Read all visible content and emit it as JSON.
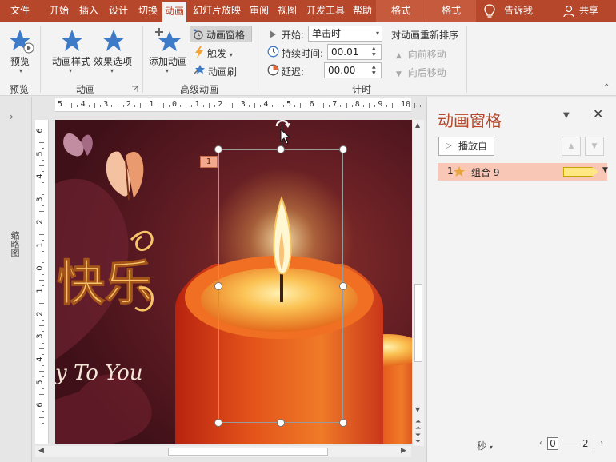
{
  "tabs": {
    "file": "文件",
    "home": "开始",
    "insert": "插入",
    "design": "设计",
    "transitions": "切换",
    "animations": "动画",
    "slideshow": "幻灯片放映",
    "review": "审阅",
    "view": "视图",
    "developer": "开发工具",
    "help": "帮助",
    "format1": "格式",
    "format2": "格式",
    "tellme": "告诉我",
    "share": "共享"
  },
  "ribbon": {
    "preview_btn": "预览",
    "preview_group": "预览",
    "anim_style_btn": "动画样式",
    "effect_opts_btn": "效果选项",
    "animation_group": "动画",
    "add_anim_btn": "添加动画",
    "anim_pane_btn": "动画窗格",
    "trigger_btn": "触发",
    "anim_painter_btn": "动画刷",
    "advanced_group": "高级动画",
    "start_label": "开始:",
    "start_value": "单击时",
    "duration_label": "持续时间:",
    "duration_value": "00.01",
    "delay_label": "延迟:",
    "delay_value": "00.00",
    "timing_group": "计时",
    "reorder_label": "对动画重新排序",
    "move_earlier": "向前移动",
    "move_later": "向后移动"
  },
  "left_strip": {
    "label": "缩略图"
  },
  "hruler": {
    "ticks": [
      "5",
      "4",
      "3",
      "2",
      "1",
      "0",
      "1",
      "2",
      "3",
      "4",
      "5",
      "6",
      "7",
      "8",
      "9",
      "10"
    ]
  },
  "vruler": {
    "ticks": [
      "6",
      "5",
      "4",
      "3",
      "2",
      "1",
      "0",
      "1",
      "2",
      "3",
      "4",
      "5",
      "6"
    ]
  },
  "slide": {
    "anim_tag": "1",
    "title_text": "快乐",
    "script_text": "y To You"
  },
  "pane": {
    "title": "动画窗格",
    "play_from": "播放自",
    "item_number": "1",
    "item_name": "组合 9",
    "seconds": "秒",
    "timeline_start": "0",
    "timeline_end": "2"
  },
  "colors": {
    "accent": "#b7472a",
    "item_bg": "#f8c7b6",
    "bar": "#ffe784"
  }
}
